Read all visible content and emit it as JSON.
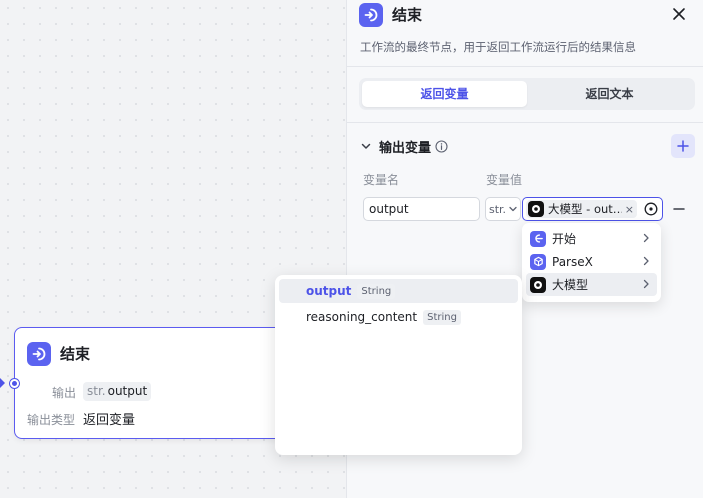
{
  "canvas_node": {
    "title": "结束",
    "output_label": "输出",
    "output_type_prefix": "str.",
    "output_value": "output",
    "type_label": "输出类型",
    "type_value": "返回变量"
  },
  "panel": {
    "title": "结束",
    "description": "工作流的最终节点，用于返回工作流运行后的结果信息",
    "tabs": [
      {
        "label": "返回变量",
        "active": true
      },
      {
        "label": "返回文本",
        "active": false
      }
    ],
    "section_title": "输出变量",
    "col_name": "变量名",
    "col_value": "变量值",
    "variable": {
      "name": "output",
      "type": "str.",
      "ref_label": "大模型 - out…",
      "ref_close": "×"
    }
  },
  "source_menu": {
    "items": [
      {
        "label": "开始",
        "icon": "start-icon"
      },
      {
        "label": "ParseX",
        "icon": "parsex-icon"
      },
      {
        "label": "大模型",
        "icon": "llm-icon"
      }
    ]
  },
  "field_menu": {
    "items": [
      {
        "name": "output",
        "type": "String",
        "selected": true
      },
      {
        "name": "reasoning_content",
        "type": "String",
        "selected": false
      }
    ]
  },
  "colors": {
    "accent": "#4d53e8",
    "node_icon": "#5b63f0",
    "selected_bg": "#eceef2"
  }
}
